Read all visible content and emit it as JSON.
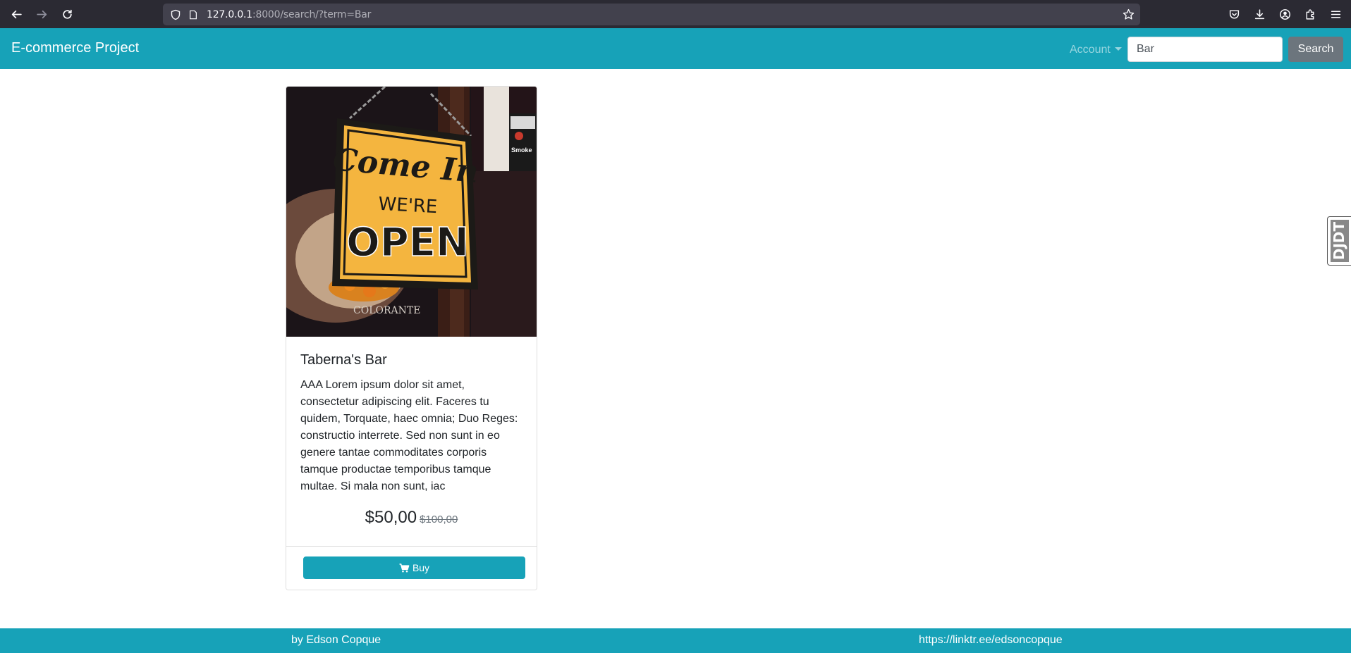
{
  "browser": {
    "url_host": "127.0.0.1",
    "url_rest": ":8000/search/?term=Bar"
  },
  "navbar": {
    "brand": "E-commerce Project",
    "account_label": "Account",
    "search_value": "Bar",
    "search_button": "Search",
    "color": "#17a2b8"
  },
  "product": {
    "title": "Taberna's Bar",
    "description": "AAA Lorem ipsum dolor sit amet, consectetur adipiscing elit. Faceres tu quidem, Torquate, haec omnia; Duo Reges: constructio interrete. Sed non sunt in eo genere tantae commoditates corporis tamque productae temporibus tamque multae. Si mala non sunt, iac",
    "price": "$50,00",
    "old_price": "$100,00",
    "buy_label": "Buy",
    "image": {
      "sign_line1": "Come In",
      "sign_line2": "WE'RE",
      "sign_line3": "OPEN",
      "watermark": "COLORANTE",
      "box_label": "Smoke"
    }
  },
  "djdt": {
    "label": "DJDT"
  },
  "footer": {
    "author": "by Edson Copque",
    "link": "https://linktr.ee/edsoncopque"
  }
}
